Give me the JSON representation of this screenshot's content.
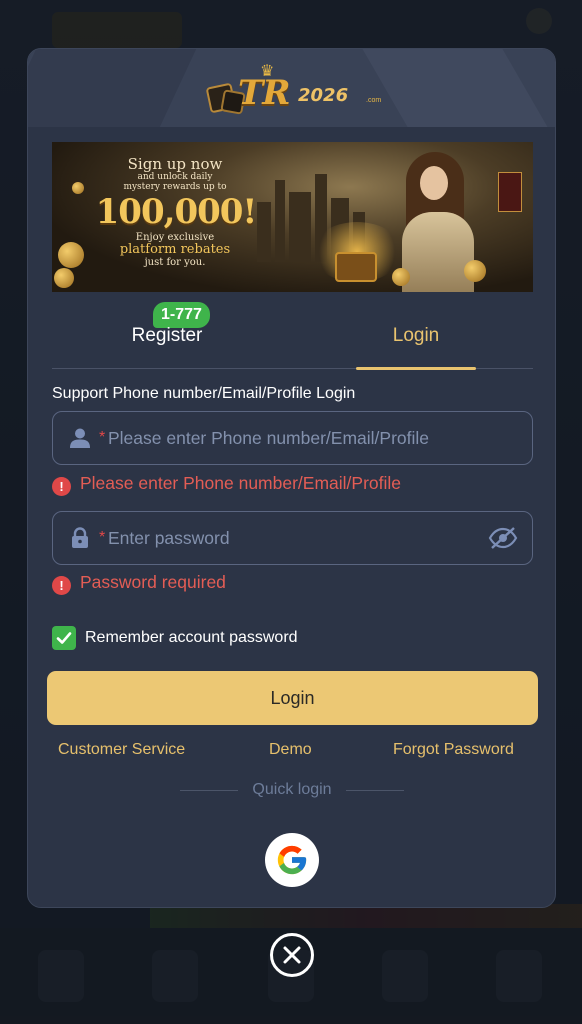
{
  "header": {
    "logo_text": "TR",
    "logo_year": "2026",
    "logo_domain": ".com"
  },
  "banner": {
    "line1": "Sign up now",
    "line2": "and unlock daily",
    "line3": "mystery rewards up to",
    "amount": "100,000!",
    "line4": "Enjoy exclusive",
    "line5": "platform rebates",
    "line6": "just for you."
  },
  "tabs": {
    "register_label": "Register",
    "register_badge": "1-777",
    "login_label": "Login",
    "active": "login"
  },
  "form": {
    "support_label": "Support Phone number/Email/Profile Login",
    "required_mark": "*",
    "user_placeholder": "Please enter Phone number/Email/Profile",
    "user_value": "",
    "user_error": "Please enter Phone number/Email/Profile",
    "password_placeholder": "Enter password",
    "password_value": "",
    "password_error": "Password required",
    "error_icon": "!",
    "remember_label": "Remember account password",
    "remember_checked": true,
    "submit_label": "Login"
  },
  "links": {
    "customer_service": "Customer Service",
    "demo": "Demo",
    "forgot_password": "Forgot Password"
  },
  "quick_login": {
    "label": "Quick login",
    "providers": [
      "google-icon"
    ]
  },
  "colors": {
    "accent": "#ecc874",
    "link": "#e6c06c",
    "error": "#e35d55",
    "success": "#3fb44b",
    "modal_bg": "#2c3446"
  }
}
